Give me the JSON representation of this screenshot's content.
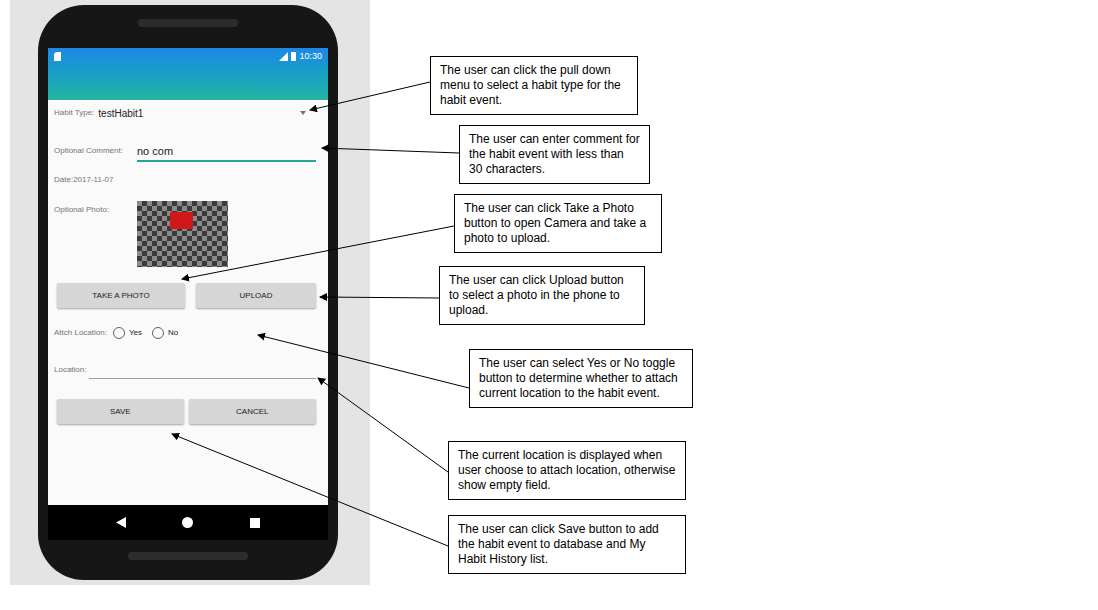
{
  "phone": {
    "status_bar": {
      "time": "10:30"
    },
    "form": {
      "habit_type": {
        "label": "Habit Type:",
        "value": "testHabit1"
      },
      "comment": {
        "label": "Optional Comment:",
        "value": "no com"
      },
      "date": {
        "label": "Date:",
        "value": "2017-11-07"
      },
      "photo": {
        "label": "Optional Photo:"
      },
      "photo_buttons": [
        "TAKE A PHOTO",
        "UPLOAD"
      ],
      "attach_location": {
        "label": "Attch Location:",
        "options": [
          {
            "label": "Yes",
            "selected": false
          },
          {
            "label": "No",
            "selected": false
          }
        ]
      },
      "location": {
        "label": "Location:"
      },
      "actions": [
        "SAVE",
        "CANCEL"
      ]
    }
  },
  "annotations": [
    {
      "text": "The user can click the pull down menu to select a habit type for the habit event."
    },
    {
      "text": "The user can enter comment for the habit event with less than 30 characters."
    },
    {
      "text": "The user can click Take a Photo button to open Camera and take a photo to upload."
    },
    {
      "text": "The user can click Upload button to select a photo in the phone to upload."
    },
    {
      "text": "The user can select Yes or No toggle button to determine whether to attach current location to the habit event."
    },
    {
      "text": "The current location is displayed when user choose to attach location, otherwise show empty field."
    },
    {
      "text": "The user can click Save button to add the habit event to database and My Habit History list."
    }
  ]
}
